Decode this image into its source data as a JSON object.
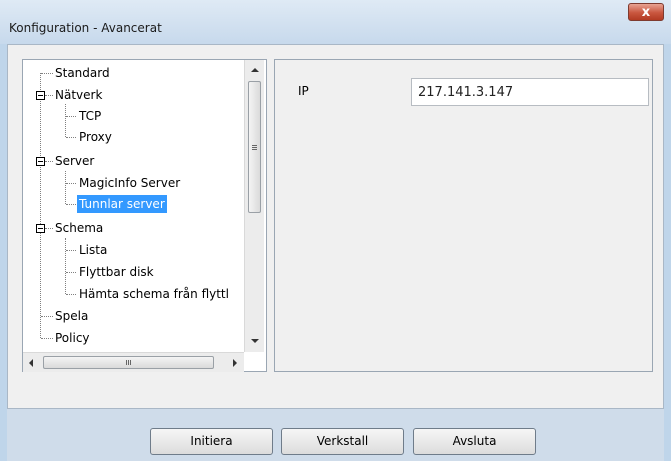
{
  "window": {
    "title": "Konfiguration - Avancerat",
    "close_label": "x"
  },
  "tree": {
    "items": [
      {
        "label": "Standard",
        "level": 0
      },
      {
        "label": "Nätverk",
        "level": 0
      },
      {
        "label": "TCP",
        "level": 1
      },
      {
        "label": "Proxy",
        "level": 1
      },
      {
        "label": "Server",
        "level": 0
      },
      {
        "label": "MagicInfo Server",
        "level": 1
      },
      {
        "label": "Tunnlar server",
        "level": 1,
        "selected": true
      },
      {
        "label": "Schema",
        "level": 0
      },
      {
        "label": "Lista",
        "level": 1
      },
      {
        "label": "Flyttbar disk",
        "level": 1
      },
      {
        "label": "Hämta schema från flyttl",
        "level": 1
      },
      {
        "label": "Spela",
        "level": 0
      },
      {
        "label": "Policy",
        "level": 0
      }
    ]
  },
  "settings": {
    "ip_label": "IP",
    "ip_value": "217.141.3.147"
  },
  "buttons": {
    "initiera": "Initiera",
    "verkstall": "Verkstall",
    "avsluta": "Avsluta"
  },
  "colors": {
    "selection": "#3399ff",
    "close": "#c9563f"
  },
  "icons": {
    "close": "close-icon",
    "scroll_up": "arrow-up-icon",
    "scroll_down": "arrow-down-icon",
    "scroll_left": "arrow-left-icon",
    "scroll_right": "arrow-right-icon"
  }
}
